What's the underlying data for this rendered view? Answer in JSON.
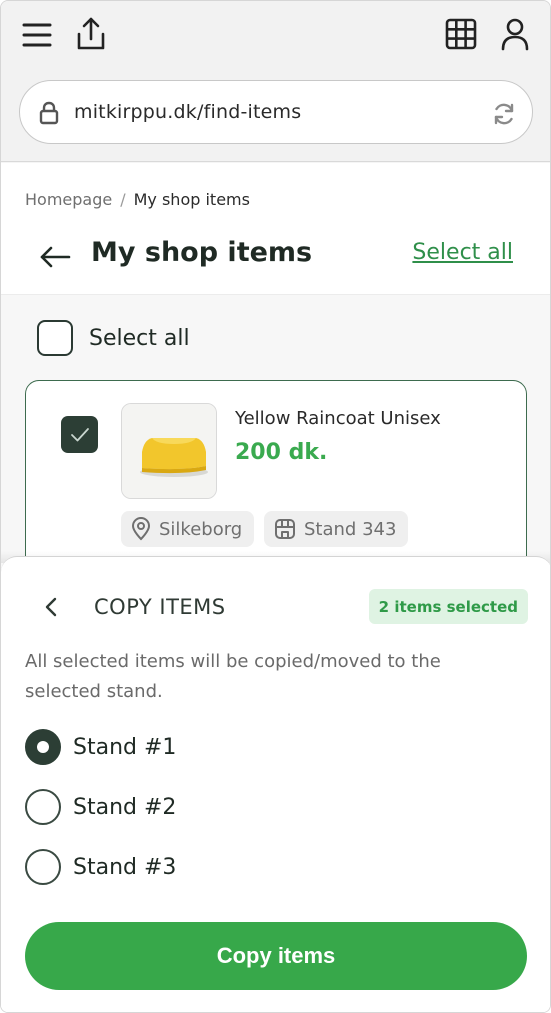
{
  "browser": {
    "url": "mitkirppu.dk/find-items",
    "icons": [
      "menu-icon",
      "share-icon",
      "grid-icon",
      "user-icon",
      "lock-icon",
      "reload-icon"
    ]
  },
  "breadcrumb": {
    "home": "Homepage",
    "separator": "/",
    "current": "My shop items"
  },
  "header": {
    "title": "My shop items",
    "select_all_link": "Select all"
  },
  "list": {
    "select_all_label": "Select all",
    "items": [
      {
        "name": "Yellow Raincoat Unisex",
        "price": "200 dk.",
        "location": "Silkeborg",
        "stand": "Stand 343",
        "checked": true
      }
    ]
  },
  "sheet": {
    "title": "COPY ITEMS",
    "badge": "2 items selected",
    "description": "All selected items will be copied/moved to the selected stand.",
    "options": [
      {
        "label": "Stand #1",
        "selected": true
      },
      {
        "label": "Stand #2",
        "selected": false
      },
      {
        "label": "Stand #3",
        "selected": false
      }
    ],
    "button_label": "Copy items"
  },
  "colors": {
    "accent_green": "#37a84a",
    "price_green": "#3aaa4f",
    "dark_check": "#2c3e35",
    "badge_bg": "#dff3e3"
  }
}
